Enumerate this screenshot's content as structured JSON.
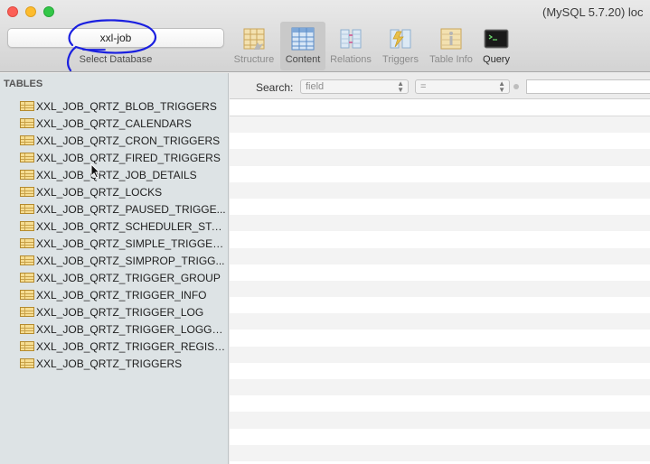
{
  "window": {
    "title": "(MySQL 5.7.20) loc"
  },
  "database": {
    "selected": "xxl-job",
    "label": "Select Database"
  },
  "toolbar": {
    "buttons": [
      {
        "label": "Structure",
        "icon": "structure-icon",
        "active": false
      },
      {
        "label": "Content",
        "icon": "content-icon",
        "active": true
      },
      {
        "label": "Relations",
        "icon": "relations-icon",
        "active": false
      },
      {
        "label": "Triggers",
        "icon": "triggers-icon",
        "active": false
      },
      {
        "label": "Table Info",
        "icon": "table-info-icon",
        "active": false
      },
      {
        "label": "Query",
        "icon": "query-icon",
        "active": false
      }
    ]
  },
  "sidebar": {
    "heading": "TABLES",
    "tables": [
      "XXL_JOB_QRTZ_BLOB_TRIGGERS",
      "XXL_JOB_QRTZ_CALENDARS",
      "XXL_JOB_QRTZ_CRON_TRIGGERS",
      "XXL_JOB_QRTZ_FIRED_TRIGGERS",
      "XXL_JOB_QRTZ_JOB_DETAILS",
      "XXL_JOB_QRTZ_LOCKS",
      "XXL_JOB_QRTZ_PAUSED_TRIGGE...",
      "XXL_JOB_QRTZ_SCHEDULER_STATE",
      "XXL_JOB_QRTZ_SIMPLE_TRIGGERS",
      "XXL_JOB_QRTZ_SIMPROP_TRIGG...",
      "XXL_JOB_QRTZ_TRIGGER_GROUP",
      "XXL_JOB_QRTZ_TRIGGER_INFO",
      "XXL_JOB_QRTZ_TRIGGER_LOG",
      "XXL_JOB_QRTZ_TRIGGER_LOGGLUE",
      "XXL_JOB_QRTZ_TRIGGER_REGISTRY",
      "XXL_JOB_QRTZ_TRIGGERS"
    ]
  },
  "filter": {
    "search_label": "Search:",
    "field_select": "field",
    "operator_select": "=",
    "value": ""
  },
  "colors": {
    "sidebar_bg": "#dde3e5",
    "annotation_blue": "#1a1fe0",
    "active_tab_bg": "#c9c9c9"
  }
}
